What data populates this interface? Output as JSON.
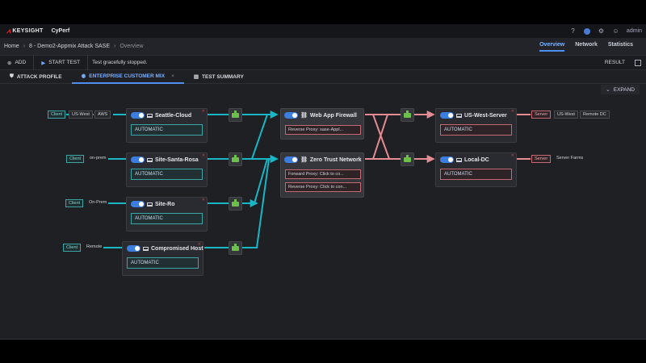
{
  "app": {
    "brand": "KEYSIGHT",
    "product": "CyPerf",
    "user": "admin"
  },
  "breadcrumb": [
    "Home",
    "8 - Demo2-Appmix Attack SASE",
    "Overview"
  ],
  "nav_tabs": [
    "Overview",
    "Network",
    "Statistics"
  ],
  "toolbar": {
    "add": "ADD",
    "start_test": "START TEST",
    "status": "Test gracefully stopped.",
    "result": "RESULT"
  },
  "tabs": [
    "ATTACK PROFILE",
    "ENTERPRISE CUSTOMER MIX",
    "TEST SUMMARY"
  ],
  "expand": "EXPAND",
  "client_nodes": [
    {
      "name": "Seattle-Cloud",
      "mode": "AUTOMATIC",
      "tag": "Client",
      "labels": [
        "US-West",
        "AWS"
      ]
    },
    {
      "name": "Site-Santa-Rosa",
      "mode": "AUTOMATIC",
      "tag": "Client",
      "labels": [
        "on-prem"
      ]
    },
    {
      "name": "Site-Ro",
      "mode": "AUTOMATIC",
      "tag": "Client",
      "labels": [
        "On-Prem"
      ]
    },
    {
      "name": "Compromised Host",
      "mode": "AUTOMATIC",
      "tag": "Client",
      "labels": [
        "Remote"
      ]
    }
  ],
  "middle_nodes": [
    {
      "name": "Web App Firewall",
      "proxies": [
        "Reverse Proxy: sase-Appl..."
      ]
    },
    {
      "name": "Zero Trust Network",
      "proxies": [
        "Forward Proxy: Click to co...",
        "Reverse Proxy: Click to con..."
      ]
    }
  ],
  "server_nodes": [
    {
      "name": "US-West-Server",
      "mode": "AUTOMATIC",
      "tag": "Server",
      "labels": [
        "US-West",
        "Remote DC"
      ]
    },
    {
      "name": "Local-DC",
      "mode": "AUTOMATIC",
      "tag": "Server",
      "labels": [
        "Server Farms"
      ]
    }
  ],
  "colors": {
    "client_link": "#19b7c6",
    "server_link": "#e58b94",
    "accent": "#4f8ff0",
    "gateway": "#6bbf4a"
  }
}
